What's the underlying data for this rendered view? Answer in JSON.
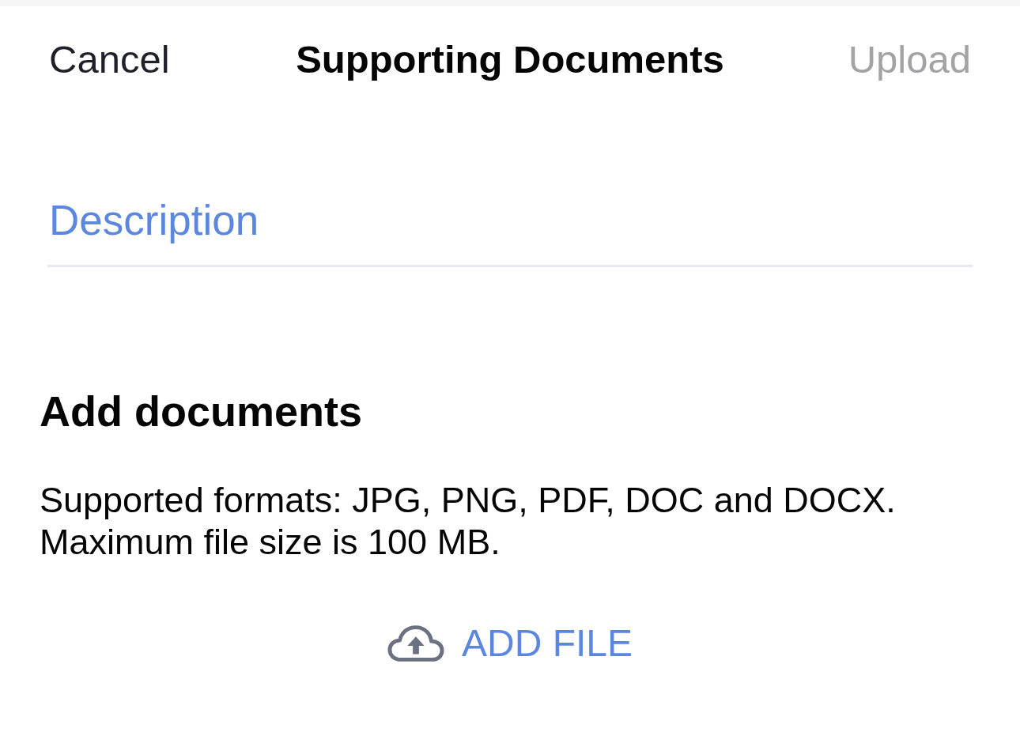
{
  "nav": {
    "cancel": "Cancel",
    "title": "Supporting Documents",
    "upload": {
      "label": "Upload",
      "disabled": true
    }
  },
  "description_field": {
    "placeholder": "Description"
  },
  "documents": {
    "title": "Add documents",
    "info": "Supported formats: JPG, PNG, PDF, DOC and DOCX.\nMaximum file size is 100 MB.",
    "add_file": "ADD FILE"
  }
}
